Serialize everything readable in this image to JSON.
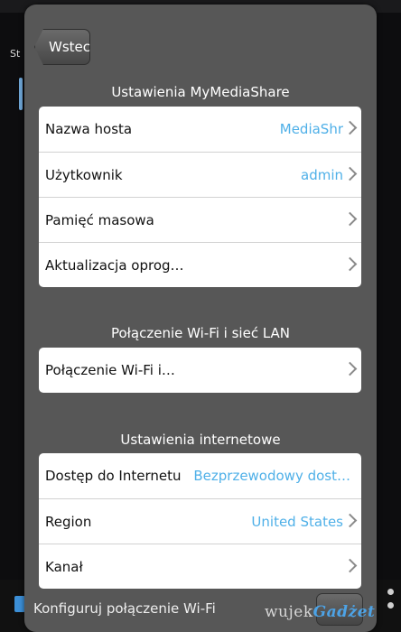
{
  "background": {
    "side_text": "St"
  },
  "dialog": {
    "back_label": "Wstecz",
    "sections": [
      {
        "title": "Ustawienia MyMediaShare",
        "rows": [
          {
            "label": "Nazwa hosta",
            "value": "MediaShr"
          },
          {
            "label": "Użytkownik",
            "value": "admin"
          },
          {
            "label": "Pamięć masowa",
            "value": ""
          },
          {
            "label": "Aktualizacja oprog…",
            "value": ""
          }
        ]
      },
      {
        "title": "Połączenie Wi-Fi i sieć LAN",
        "rows": [
          {
            "label": "Połączenie Wi-Fi i…",
            "value": ""
          }
        ]
      },
      {
        "title": "Ustawienia internetowe",
        "rows": [
          {
            "label": "Dostęp do Internetu",
            "value": "Bezprzewodowy dost…"
          },
          {
            "label": "Region",
            "value": "United States"
          },
          {
            "label": "Kanał",
            "value": ""
          }
        ]
      }
    ],
    "footer_text": "Konfiguruj połączenie Wi-Fi"
  },
  "watermark": {
    "part1": "wujek",
    "part2": "Gadżet"
  },
  "colors": {
    "accent": "#4fb0e8",
    "dialog_bg": "#575757"
  }
}
